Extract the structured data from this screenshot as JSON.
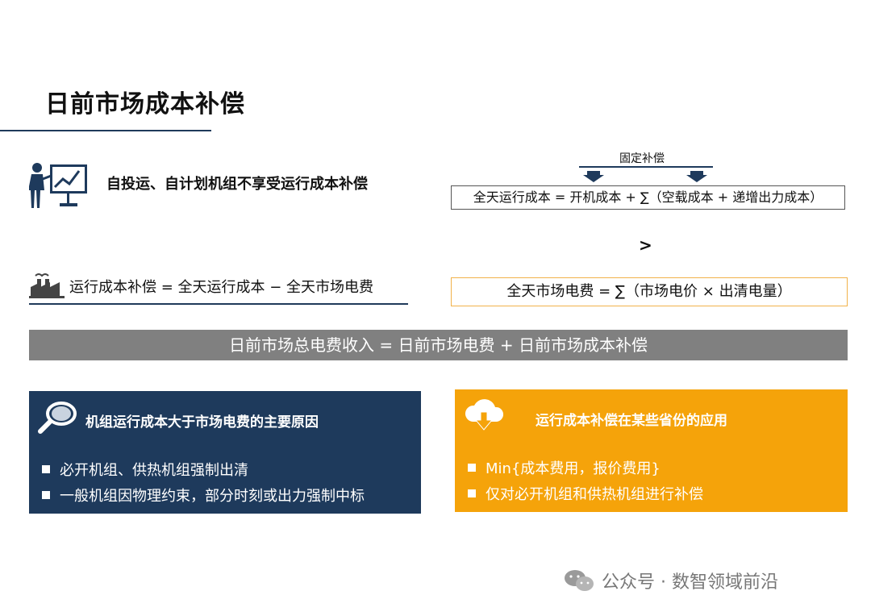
{
  "title": "日前市场成本补偿",
  "note_self_dispatch": "自投运、自计划机组不享受运行成本补偿",
  "fixed_comp_label": "固定补偿",
  "formula_daily_cost": "全天运行成本 = 开机成本 + ∑（空载成本 + 递增出力成本）",
  "comparison_symbol": ">",
  "formula_comp": "运行成本补偿 = 全天运行成本 − 全天市场电费",
  "formula_market_fee": "全天市场电费  = ∑（市场电价 × 出清电量）",
  "total_bar": "日前市场总电费收入 = 日前市场电费 + 日前市场成本补偿",
  "left_panel": {
    "heading": "机组运行成本大于市场电费的主要原因",
    "bullets": [
      "必开机组、供热机组强制出清",
      "一般机组因物理约束，部分时刻或出力强制中标"
    ]
  },
  "right_panel": {
    "heading": "运行成本补偿在某些省份的应用",
    "bullets": [
      "Min{成本费用，报价费用}",
      "仅对必开机组和供热机组进行补偿"
    ]
  },
  "watermark": "公众号 · 数智领域前沿",
  "colors": {
    "navy": "#1e3a5c",
    "orange": "#f5a30a",
    "gray_bar": "#808080",
    "orange_border": "#f2b24a"
  },
  "icons": {
    "presenter": "presenter-icon",
    "factory": "factory-icon",
    "search": "magnifier-icon",
    "download": "cloud-download-icon",
    "wechat": "wechat-icon"
  }
}
